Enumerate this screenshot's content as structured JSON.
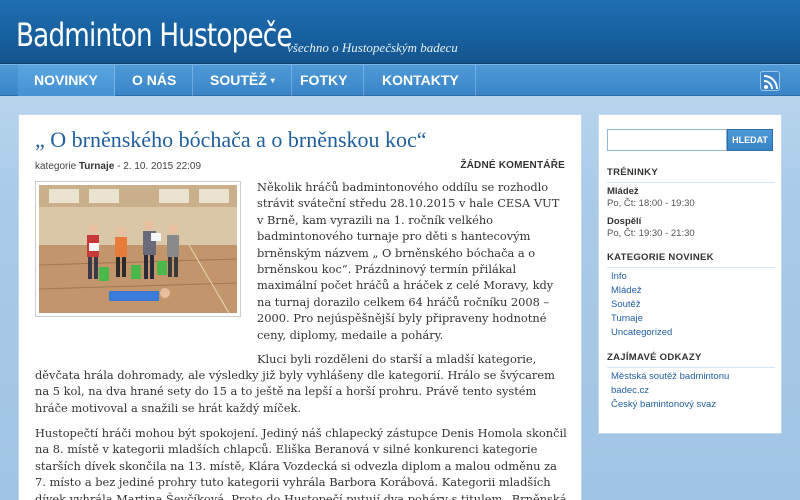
{
  "header": {
    "title": "Badminton Hustopeče",
    "tagline": "všechno o Hustopečským badecu"
  },
  "nav": {
    "items": [
      {
        "label": "NOVINKY"
      },
      {
        "label": "O NÁS"
      },
      {
        "label": "SOUTĚŽ",
        "caret": "▾"
      },
      {
        "label": "FOTKY"
      },
      {
        "label": "KONTAKTY"
      }
    ],
    "rss_icon": "rss-icon"
  },
  "post": {
    "title": "„ O brněnského bóchača a o brněnskou koc“",
    "meta_prefix": "kategorie",
    "category": "Turnaje",
    "date": "- 2. 10. 2015 22:09",
    "comments": "ŽÁDNÉ KOMENTÁŘE",
    "para1_float": "Několik hráčů badmintonového oddílu se rozhodlo strávit sváteční středu 28.10.2015 v hale CESA VUT v Brně, kam vyrazili na 1. ročník velkého badmintonového turnaje pro děti s hantecovým brněnským názvem „ O brněnského bóchača a o brněnskou koc“. Prázdninový termín přilákal maximální počet hráčů a hráček z celé Moravy, kdy na turnaj dorazilo celkem 64 hráčů ročníku 2008 – 2000. Pro nejúspěšnější byly připraveny hodnotné ceny, diplomy, medaile a poháry.",
    "para2_first_line": "Kluci byli rozděleni do starší a mladší kategorie,",
    "para2_rest": "děvčata hrála dohromady, ale výsledky již byly vyhlášeny dle kategorií. Hrálo se švýcarem na 5 kol, na dva hrané sety do 15 a to ještě na lepší a horší prohru. Právě tento systém hráče motivoval a snažili se hrát každý míček.",
    "para3": "Hustopečtí hráči mohou být spokojení. Jediný náš chlapecký zástupce Denis Homola skončil na 8. místě v kategorii mladších chlapců. Eliška Beranová v silné konkurenci kategorie starších dívek skončila na 13. místě, Klára Vozdecká si odvezla diplom a malou odměnu za 7. místo a bez jediné prohry tuto kategorii vyhrála Barbora Korábová. Kategorii mladších dívek vyhrála Martina Ševčíková. Proto do Hustopečí putují dva poháry s titulem „Brněnská koc“."
  },
  "sidebar": {
    "search": {
      "placeholder": "",
      "button": "HLEDAT"
    },
    "trainings": {
      "heading": "TRÉNINKY",
      "groups": [
        {
          "label": "Mládež",
          "time": "Po, Čt: 18:00 - 19:30"
        },
        {
          "label": "Dospělí",
          "time": "Po, Čt: 19:30 - 21:30"
        }
      ]
    },
    "categories": {
      "heading": "KATEGORIE NOVINEK",
      "items": [
        "Info",
        "Mládež",
        "Soutěž",
        "Turnaje",
        "Uncategorized"
      ]
    },
    "links": {
      "heading": "ZAJÍMAVÉ ODKAZY",
      "items": [
        "Městská soutěž badmintonu",
        "badec.cz",
        "Český bamintonový svaz"
      ]
    }
  }
}
